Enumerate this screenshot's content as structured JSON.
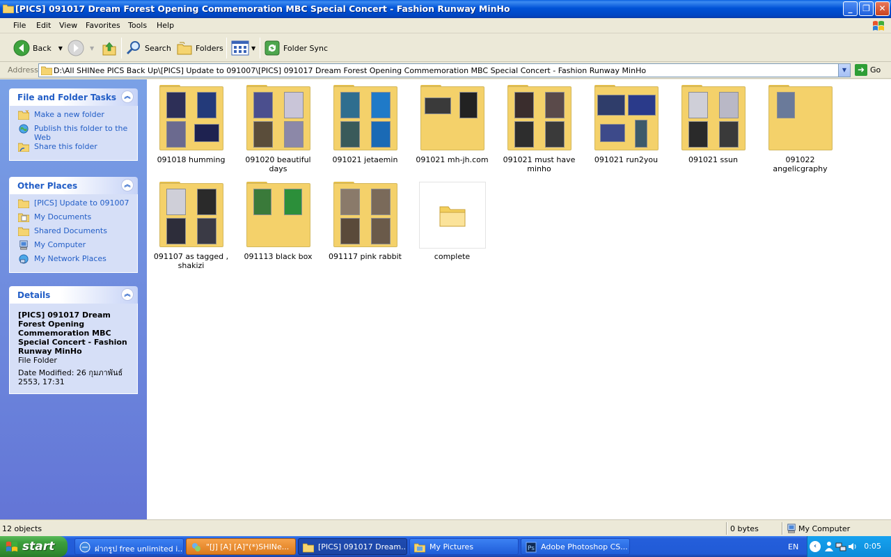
{
  "window": {
    "title": "[PICS] 091017 Dream Forest Opening Commemoration MBC Special Concert - Fashion Runway MinHo",
    "minimize_icon": "minimize-icon",
    "maximize_icon": "restore-icon",
    "close_icon": "close-icon"
  },
  "menu": [
    "File",
    "Edit",
    "View",
    "Favorites",
    "Tools",
    "Help"
  ],
  "toolbar": {
    "back_label": "Back",
    "search_label": "Search",
    "folders_label": "Folders",
    "folder_sync_label": "Folder Sync"
  },
  "address": {
    "label": "Address",
    "value": "D:\\All SHINee PICS Back Up\\[PICS] Update to 091007\\[PICS] 091017 Dream Forest Opening Commemoration MBC Special Concert - Fashion Runway MinHo",
    "go_label": "Go"
  },
  "left_pane": {
    "tasks": {
      "title": "File and Folder Tasks",
      "links": [
        "Make a new folder",
        "Publish this folder to the Web",
        "Share this folder"
      ]
    },
    "other_places": {
      "title": "Other Places",
      "links": [
        "[PICS] Update to 091007",
        "My Documents",
        "Shared Documents",
        "My Computer",
        "My Network Places"
      ]
    },
    "details": {
      "title": "Details",
      "name": "[PICS] 091017 Dream Forest Opening Commemoration MBC Special Concert - Fashion Runway MinHo",
      "type": "File Folder",
      "modified": "Date Modified: 26 กุมภาพันธ์ 2553, 17:31"
    }
  },
  "items": [
    {
      "name": "091018 humming"
    },
    {
      "name": "091020 beautiful days"
    },
    {
      "name": "091021 jetaemin"
    },
    {
      "name": "091021 mh-jh.com"
    },
    {
      "name": "091021 must have minho"
    },
    {
      "name": "091021 run2you"
    },
    {
      "name": "091021 ssun"
    },
    {
      "name": "091022 angelicgraphy"
    },
    {
      "name": "091107 as tagged , shakizi"
    },
    {
      "name": "091113 black box"
    },
    {
      "name": "091117 pink rabbit"
    },
    {
      "name": "complete"
    }
  ],
  "status": {
    "objects": "12 objects",
    "size": "0 bytes",
    "location": "My Computer"
  },
  "taskbar": {
    "start_label": "start",
    "tasks": [
      "ฝากรูป free unlimited i...",
      "\"[J] [A] [A]\"(*)SHINe...",
      "[PICS] 091017 Dream...",
      "My Pictures",
      "Adobe Photoshop CS..."
    ],
    "language": "EN",
    "clock": "0:05"
  }
}
